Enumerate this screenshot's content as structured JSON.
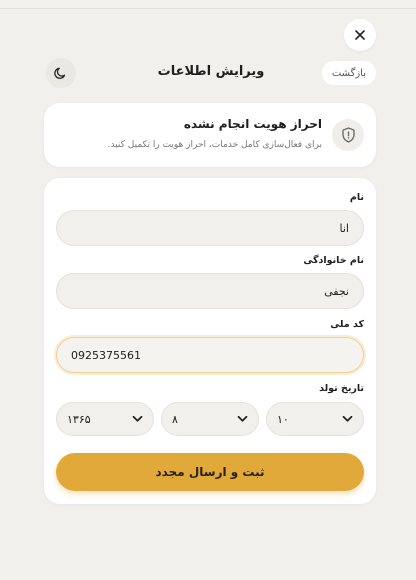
{
  "header": {
    "title": "ویرایش اطلاعات",
    "back_label": "بازگشت",
    "close_icon": "close-icon",
    "theme_icon": "moon-icon"
  },
  "status": {
    "title": "احراز هویت انجام نشده",
    "subtitle": "برای فعال‌سازی کامل خدمات، احراز هویت را تکمیل کنید.",
    "icon": "shield-icon"
  },
  "form": {
    "first_name": {
      "label": "نام",
      "value": "انا"
    },
    "last_name": {
      "label": "نام خانوادگی",
      "value": "نجفی"
    },
    "national_code": {
      "label": "کد ملی",
      "value": "0925375561"
    },
    "birth_date": {
      "label": "تاریخ تولد",
      "year": "۱۳۶۵",
      "month": "۸",
      "day": "۱۰"
    },
    "submit_label": "ثبت و ارسال مجدد"
  },
  "colors": {
    "accent": "#e0a93a",
    "background": "#f1f0ec",
    "focus": "#f0d19a"
  }
}
